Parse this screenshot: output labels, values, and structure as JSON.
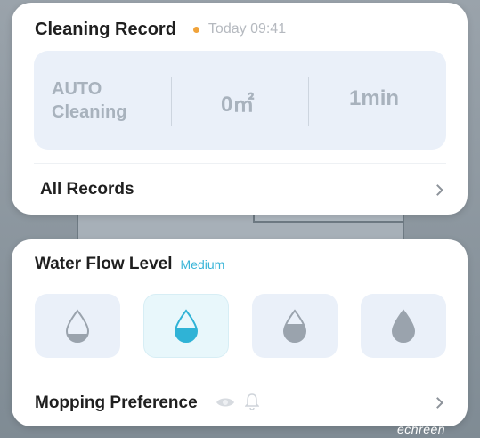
{
  "cleaning_record": {
    "title": "Cleaning Record",
    "timestamp": "Today 09:41",
    "status_color": "#f0a33a",
    "mode_line1": "AUTO",
    "mode_line2": "Cleaning",
    "area": "0㎡",
    "duration": "1min",
    "all_records_label": "All Records"
  },
  "water_flow": {
    "label": "Water Flow Level",
    "value": "Medium",
    "accent_color": "#3ab5d8",
    "options": [
      {
        "icon": "water-drop-low-icon",
        "selected": false
      },
      {
        "icon": "water-drop-medium-icon",
        "selected": true
      },
      {
        "icon": "water-drop-high-icon",
        "selected": false
      },
      {
        "icon": "water-drop-full-icon",
        "selected": false
      }
    ]
  },
  "mopping": {
    "label": "Mopping Preference",
    "icons": [
      "eye-icon",
      "bell-icon"
    ]
  },
  "watermark": "echreen"
}
